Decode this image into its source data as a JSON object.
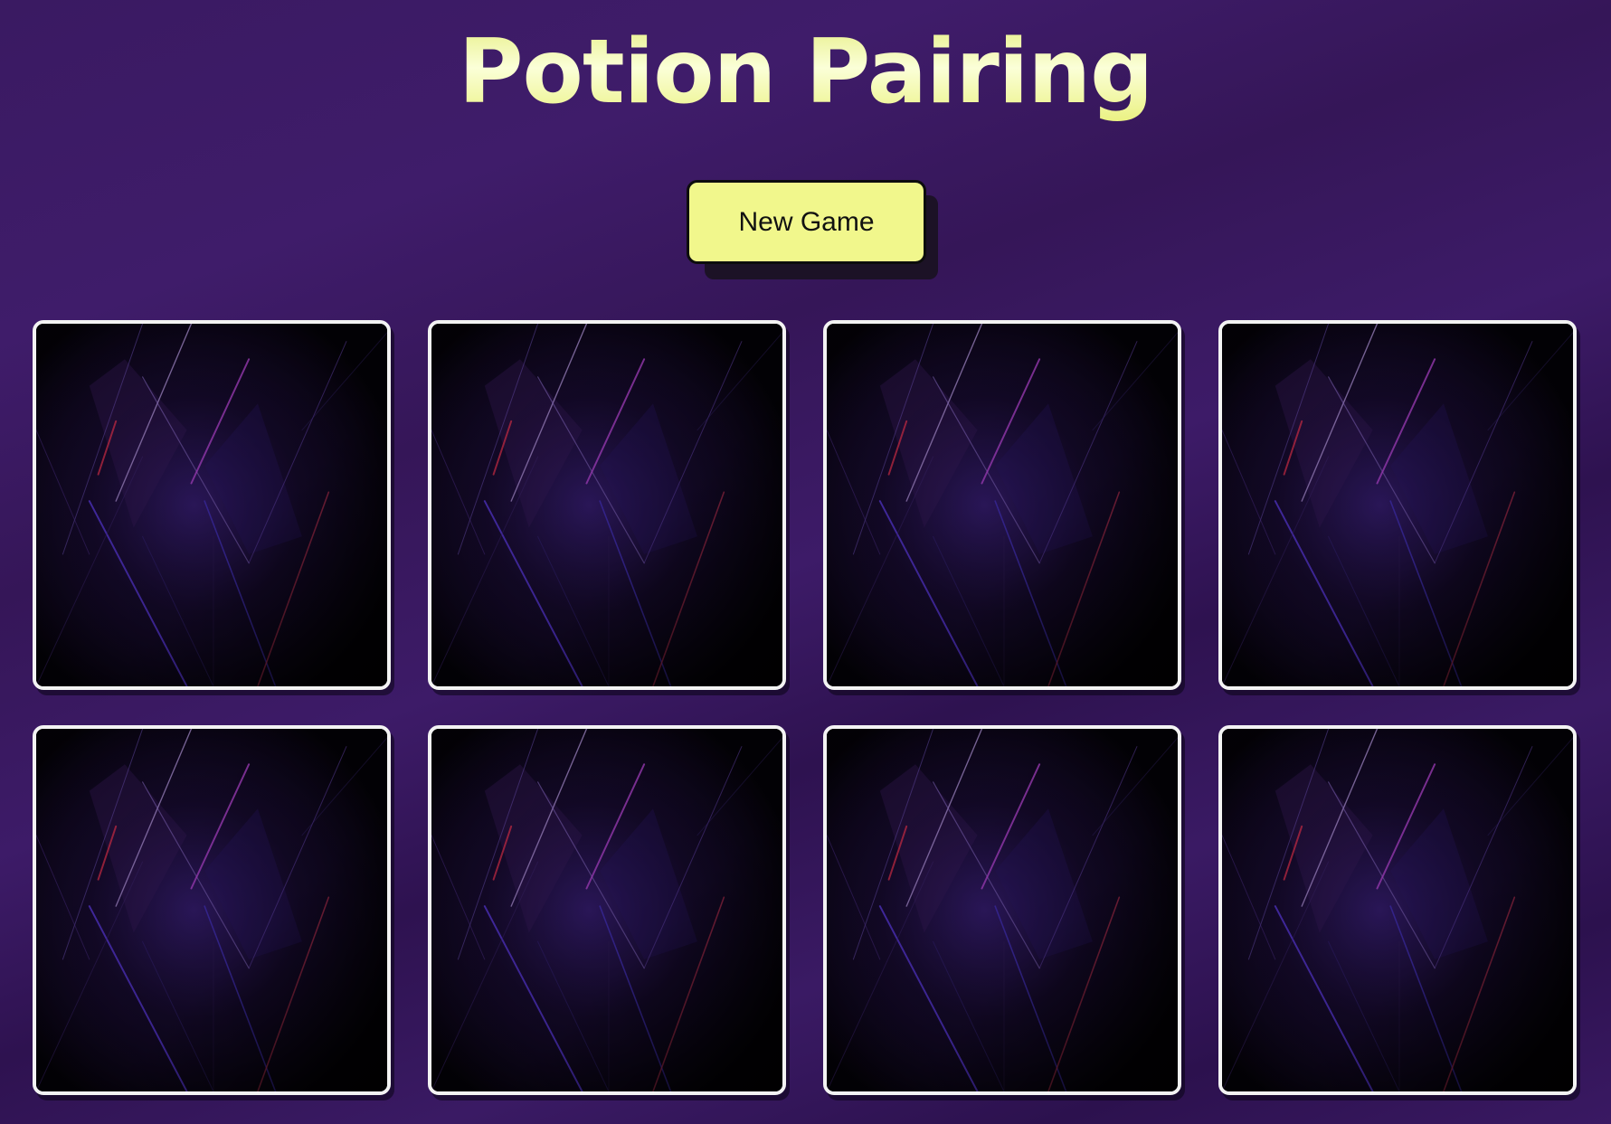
{
  "title": "Potion Pairing",
  "new_game_label": "New Game",
  "colors": {
    "title": "#f1f78c",
    "button": "#f1f78c",
    "background": "#3a1a62",
    "card_border": "#f3f3f3"
  },
  "cards": [
    {
      "face": "hidden"
    },
    {
      "face": "hidden"
    },
    {
      "face": "hidden"
    },
    {
      "face": "hidden"
    },
    {
      "face": "hidden"
    },
    {
      "face": "hidden"
    },
    {
      "face": "hidden"
    },
    {
      "face": "hidden"
    }
  ]
}
